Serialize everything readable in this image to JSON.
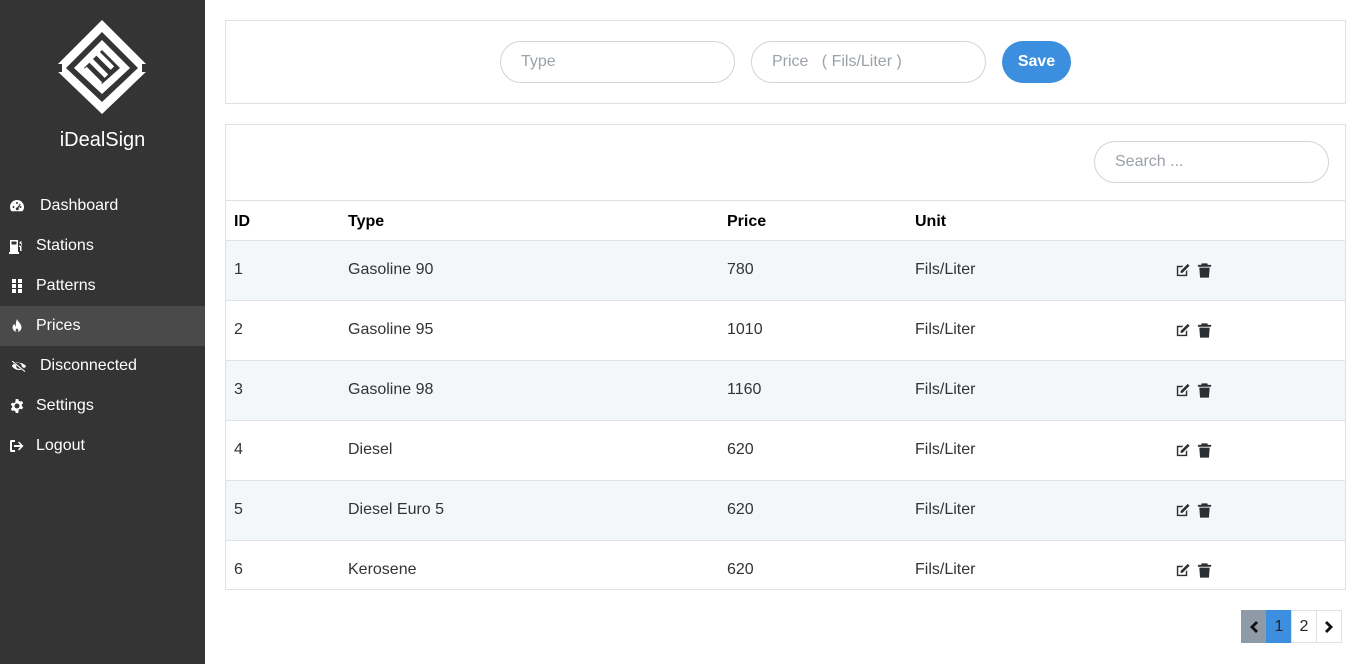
{
  "brand": {
    "name": "iDealSign",
    "logo_icon": "idealsign-logo"
  },
  "sidebar": {
    "items": [
      {
        "label": "Dashboard",
        "icon": "tachometer-icon"
      },
      {
        "label": "Stations",
        "icon": "gas-pump-icon"
      },
      {
        "label": "Patterns",
        "icon": "grip-icon"
      },
      {
        "label": "Prices",
        "icon": "fire-icon",
        "active": true
      },
      {
        "label": "Disconnected",
        "icon": "eye-slash-icon"
      },
      {
        "label": "Settings",
        "icon": "gear-icon"
      },
      {
        "label": "Logout",
        "icon": "sign-out-icon"
      }
    ]
  },
  "form": {
    "type_placeholder": "Type",
    "price_placeholder": "Price   ( Fils/Liter )",
    "save_label": "Save"
  },
  "table": {
    "search_placeholder": "Search ...",
    "columns": [
      "ID",
      "Type",
      "Price",
      "Unit"
    ],
    "rows": [
      {
        "id": "1",
        "type": "Gasoline 90",
        "price": "780",
        "unit": "Fils/Liter"
      },
      {
        "id": "2",
        "type": "Gasoline 95",
        "price": "1010",
        "unit": "Fils/Liter"
      },
      {
        "id": "3",
        "type": "Gasoline 98",
        "price": "1160",
        "unit": "Fils/Liter"
      },
      {
        "id": "4",
        "type": "Diesel",
        "price": "620",
        "unit": "Fils/Liter"
      },
      {
        "id": "5",
        "type": "Diesel Euro 5",
        "price": "620",
        "unit": "Fils/Liter"
      },
      {
        "id": "6",
        "type": "Kerosene",
        "price": "620",
        "unit": "Fils/Liter"
      }
    ]
  },
  "pagination": {
    "pages": [
      "1",
      "2"
    ],
    "current": "1"
  },
  "colors": {
    "sidebar_bg": "#343434",
    "accent": "#3b8fde",
    "row_stripe": "#f4f7fa"
  }
}
